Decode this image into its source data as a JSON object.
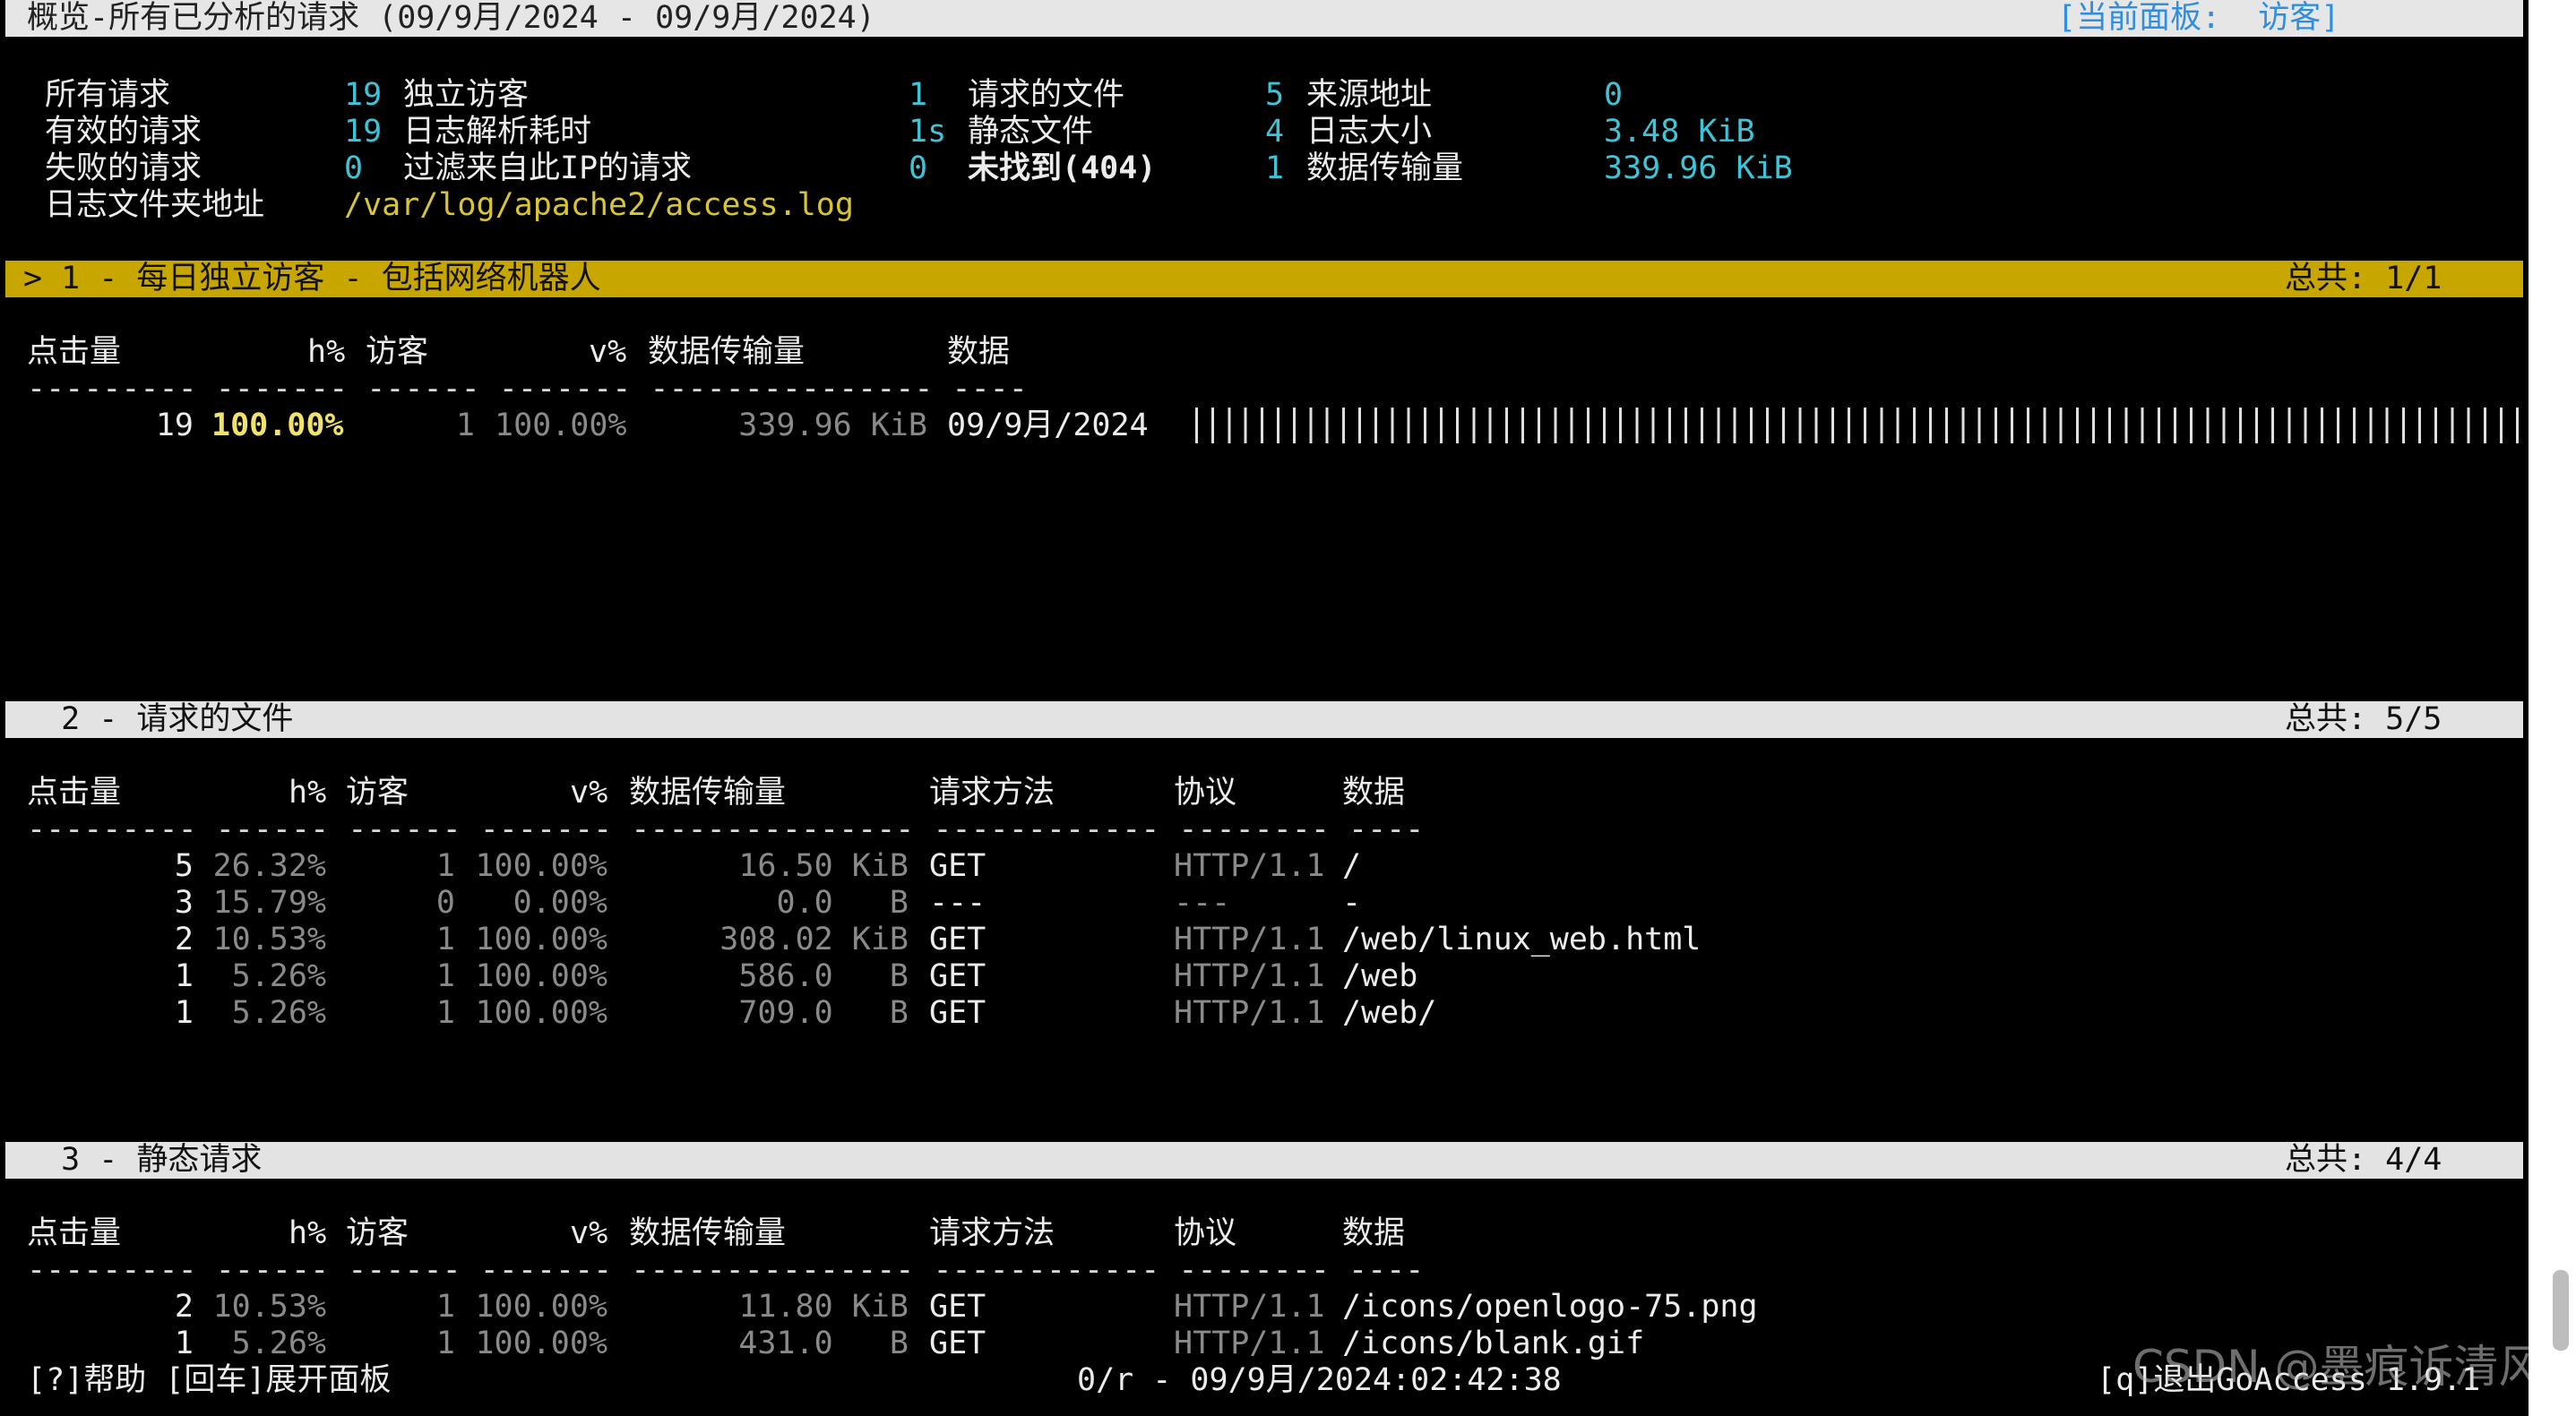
{
  "title": {
    "left": "概览-所有已分析的请求 (09/9月/2024 - 09/9月/2024)",
    "right": "[当前面板:  访客]"
  },
  "overview": {
    "col1": [
      {
        "label": "所有请求",
        "value": "19"
      },
      {
        "label": "有效的请求",
        "value": "19"
      },
      {
        "label": "失败的请求",
        "value": "0"
      },
      {
        "label": "日志文件夹地址",
        "value": "/var/log/apache2/access.log"
      }
    ],
    "col2": [
      {
        "label": "独立访客",
        "value": "1"
      },
      {
        "label": "日志解析耗时",
        "value": "1s"
      },
      {
        "label": "过滤来自此IP的请求",
        "value": "0"
      }
    ],
    "col3": [
      {
        "label": "请求的文件",
        "value": "5"
      },
      {
        "label": "静态文件",
        "value": "4"
      },
      {
        "label": "未找到(404)",
        "value": "1"
      }
    ],
    "col4": [
      {
        "label": "来源地址",
        "value": "0"
      },
      {
        "label": "日志大小",
        "value": "3.48 KiB"
      },
      {
        "label": "数据传输量",
        "value": "339.96 KiB"
      }
    ]
  },
  "panel1": {
    "header": "> 1 - 每日独立访客 - 包括网络机器人",
    "total": "总共: 1/1",
    "columns": [
      "点击量",
      "h%",
      "访客",
      "v%",
      "数据传输量",
      "数据"
    ],
    "dashes": "--------- ------- ------ ------- --------------- ----",
    "row": {
      "hits": "19",
      "hpct": "100.00%",
      "visitors": "1",
      "vpct": "100.00%",
      "bw": "339.96 KiB",
      "data": "09/9月/2024"
    }
  },
  "panel2": {
    "header": "  2 - 请求的文件",
    "total": "总共: 5/5",
    "columns": [
      "点击量",
      "h%",
      "访客",
      "v%",
      "数据传输量",
      "请求方法",
      "协议",
      "数据"
    ],
    "dashes": "--------- ------ ------ ------- --------------- ------------ -------- ----",
    "rows": [
      {
        "hits": "5",
        "hpct": "26.32%",
        "visitors": "1",
        "vpct": "100.00%",
        "bw": "16.50 KiB",
        "method": "GET",
        "proto": "HTTP/1.1",
        "data": "/"
      },
      {
        "hits": "3",
        "hpct": "15.79%",
        "visitors": "0",
        "vpct": "0.00%",
        "bw": "0.0   B",
        "method": "---",
        "proto": "---",
        "data": "-"
      },
      {
        "hits": "2",
        "hpct": "10.53%",
        "visitors": "1",
        "vpct": "100.00%",
        "bw": "308.02 KiB",
        "method": "GET",
        "proto": "HTTP/1.1",
        "data": "/web/linux_web.html"
      },
      {
        "hits": "1",
        "hpct": "5.26%",
        "visitors": "1",
        "vpct": "100.00%",
        "bw": "586.0   B",
        "method": "GET",
        "proto": "HTTP/1.1",
        "data": "/web"
      },
      {
        "hits": "1",
        "hpct": "5.26%",
        "visitors": "1",
        "vpct": "100.00%",
        "bw": "709.0   B",
        "method": "GET",
        "proto": "HTTP/1.1",
        "data": "/web/"
      }
    ]
  },
  "panel3": {
    "header": "  3 - 静态请求",
    "total": "总共: 4/4",
    "columns": [
      "点击量",
      "h%",
      "访客",
      "v%",
      "数据传输量",
      "请求方法",
      "协议",
      "数据"
    ],
    "dashes": "--------- ------ ------ ------- --------------- ------------ -------- ----",
    "rows": [
      {
        "hits": "2",
        "hpct": "10.53%",
        "visitors": "1",
        "vpct": "100.00%",
        "bw": "11.80 KiB",
        "method": "GET",
        "proto": "HTTP/1.1",
        "data": "/icons/openlogo-75.png"
      },
      {
        "hits": "1",
        "hpct": "5.26%",
        "visitors": "1",
        "vpct": "100.00%",
        "bw": "431.0   B",
        "method": "GET",
        "proto": "HTTP/1.1",
        "data": "/icons/blank.gif"
      }
    ]
  },
  "footer": {
    "help": "[?]帮助 [回车]展开面板",
    "status": "0/r - 09/9月/2024:02:42:38",
    "quit": "[q]退出GoAccess 1.9.1"
  },
  "watermark": "CSDN @墨痕诉清风"
}
